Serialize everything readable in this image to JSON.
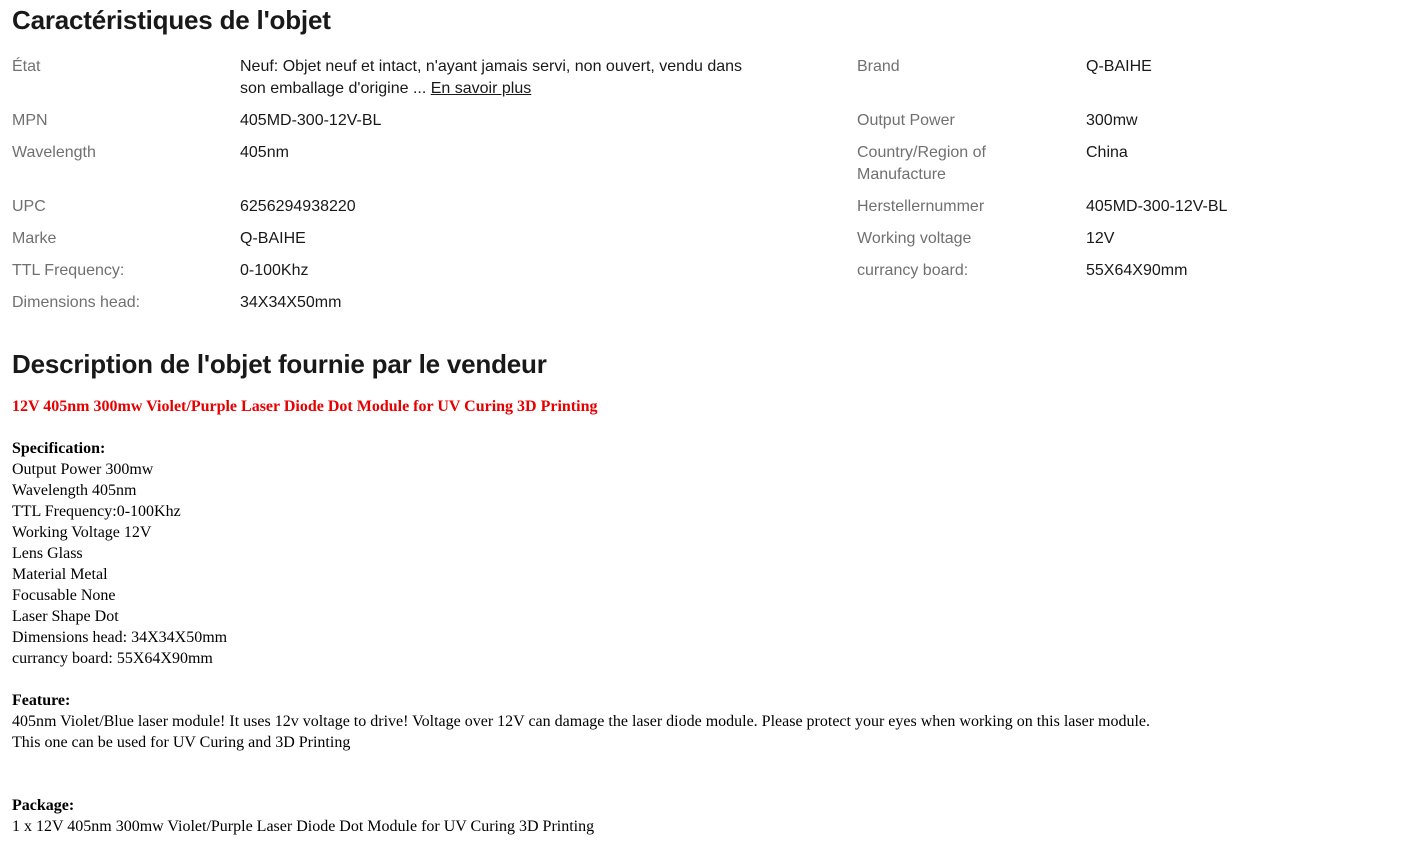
{
  "specs": {
    "title": "Caractéristiques de l'objet",
    "left": [
      {
        "label": "État",
        "value": "Neuf: Objet neuf et intact, n'ayant jamais servi, non ouvert, vendu dans son emballage d'origine ...",
        "link": "En savoir plus"
      },
      {
        "label": "MPN",
        "value": "405MD-300-12V-BL"
      },
      {
        "label": "Wavelength",
        "value": "405nm"
      },
      {
        "label": "UPC",
        "value": "6256294938220"
      },
      {
        "label": "Marke",
        "value": "Q-BAIHE"
      },
      {
        "label": "TTL Frequency:",
        "value": "0-100Khz"
      },
      {
        "label": "Dimensions head:",
        "value": "34X34X50mm"
      }
    ],
    "right": [
      {
        "label": "Brand",
        "value": "Q-BAIHE"
      },
      {
        "label": "Output Power",
        "value": "300mw"
      },
      {
        "label": "Country/Region of Manufacture",
        "value": "China"
      },
      {
        "label": "Herstellernummer",
        "value": "405MD-300-12V-BL"
      },
      {
        "label": "Working voltage",
        "value": "12V"
      },
      {
        "label": "currancy board:",
        "value": "55X64X90mm"
      }
    ]
  },
  "description": {
    "title": "Description de l'objet fournie par le vendeur",
    "headline": "12V 405nm 300mw Violet/Purple Laser Diode Dot Module for UV Curing 3D Printing",
    "headline_color": "#e60000",
    "specification": {
      "title": "Specification:",
      "lines": [
        "Output Power 300mw",
        "Wavelength 405nm",
        "TTL Frequency:0-100Khz",
        "Working Voltage 12V",
        "Lens Glass",
        "Material Metal",
        "Focusable None",
        "Laser Shape Dot",
        "Dimensions head: 34X34X50mm",
        "currancy board: 55X64X90mm"
      ]
    },
    "feature": {
      "title": "Feature:",
      "lines": [
        "405nm Violet/Blue laser module! It uses 12v voltage to drive! Voltage over 12V can damage the laser diode module. Please protect your eyes when working on this laser module.",
        "This one can be used for UV Curing and 3D Printing"
      ]
    },
    "package": {
      "title": "Package:",
      "lines": [
        "1 x 12V 405nm 300mw Violet/Purple Laser Diode Dot Module for UV Curing 3D Printing"
      ]
    }
  }
}
